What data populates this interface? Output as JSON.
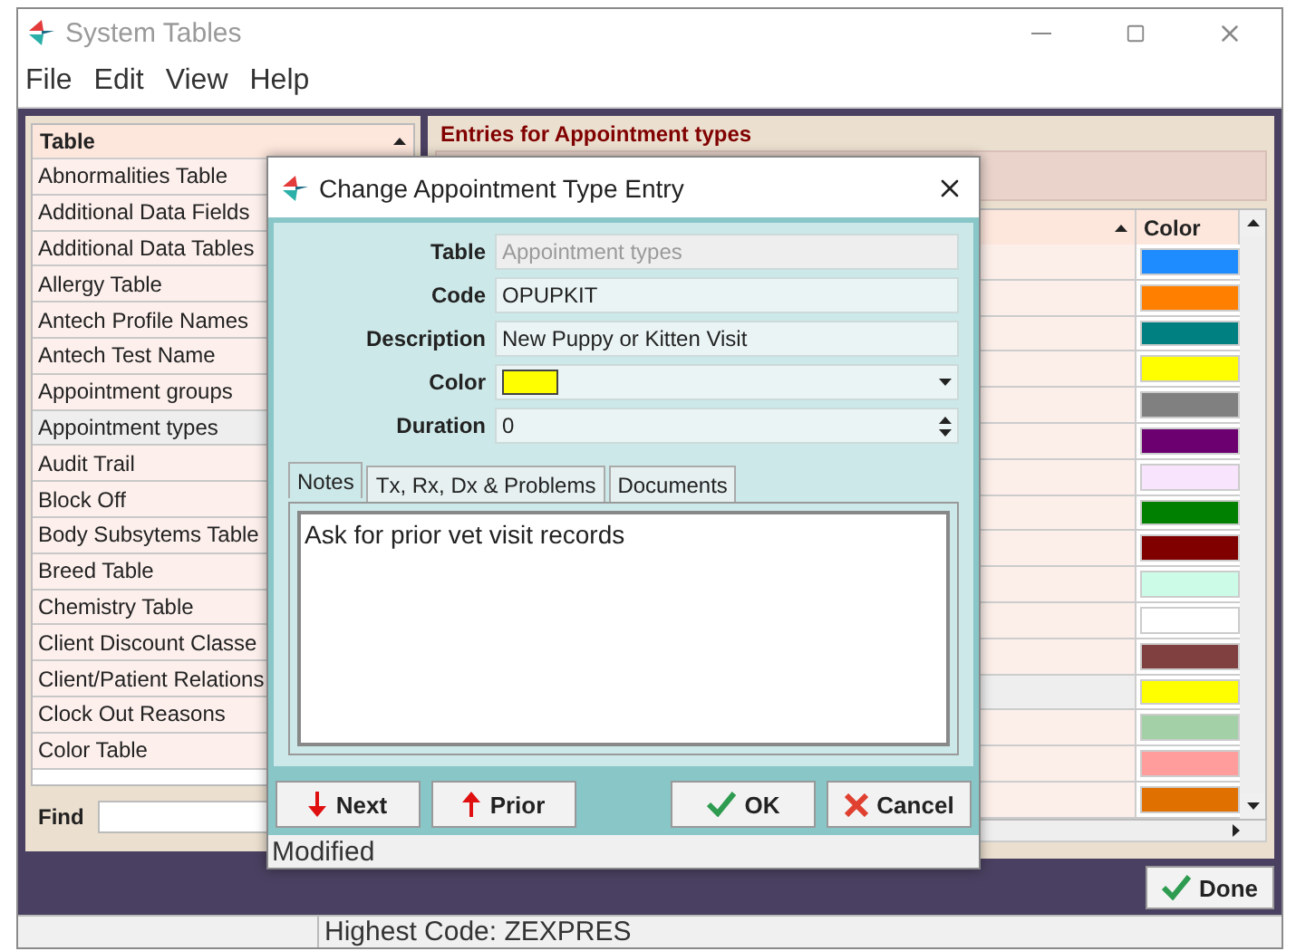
{
  "window": {
    "title": "System Tables"
  },
  "menu": [
    "File",
    "Edit",
    "View",
    "Help"
  ],
  "table_list": {
    "header": "Table",
    "items": [
      {
        "label": "Abnormalities Table",
        "selected": false
      },
      {
        "label": "Additional Data Fields",
        "selected": false
      },
      {
        "label": "Additional Data Tables",
        "selected": false
      },
      {
        "label": "Allergy Table",
        "selected": false
      },
      {
        "label": "Antech Profile Names",
        "selected": false
      },
      {
        "label": "Antech Test Name",
        "selected": false
      },
      {
        "label": "Appointment groups",
        "selected": false
      },
      {
        "label": "Appointment types",
        "selected": true
      },
      {
        "label": "Audit Trail",
        "selected": false
      },
      {
        "label": "Block Off",
        "selected": false
      },
      {
        "label": "Body Subsytems Table",
        "selected": false
      },
      {
        "label": "Breed Table",
        "selected": false
      },
      {
        "label": "Chemistry Table",
        "selected": false
      },
      {
        "label": "Client Discount Classe",
        "selected": false
      },
      {
        "label": "Client/Patient Relations",
        "selected": false
      },
      {
        "label": "Clock Out Reasons",
        "selected": false
      },
      {
        "label": "Color Table",
        "selected": false
      }
    ],
    "find_label": "Find"
  },
  "entries": {
    "title": "Entries for Appointment types",
    "color_column": "Color",
    "rows": [
      {
        "color": "#1e8cff",
        "selected": false
      },
      {
        "color": "#ff8000",
        "selected": false
      },
      {
        "color": "#008080",
        "selected": false
      },
      {
        "color": "#ffff00",
        "selected": false
      },
      {
        "color": "#808080",
        "selected": false
      },
      {
        "color": "#6c0070",
        "selected": false
      },
      {
        "color": "#f8e4fc",
        "selected": false
      },
      {
        "color": "#008000",
        "selected": false
      },
      {
        "color": "#800000",
        "selected": false
      },
      {
        "color": "#ccfce8",
        "selected": false
      },
      {
        "color": "#ffffff",
        "selected": false
      },
      {
        "color": "#804040",
        "selected": false
      },
      {
        "color": "#ffff00",
        "selected": true
      },
      {
        "color": "#a4d0a8",
        "selected": false
      },
      {
        "color": "#ff9c9c",
        "selected": false
      },
      {
        "color": "#e07000",
        "selected": false
      }
    ]
  },
  "done_button": "Done",
  "status_bar": "Highest Code: ZEXPRES",
  "dialog": {
    "title": "Change Appointment Type Entry",
    "fields": [
      {
        "kind": "text",
        "label": "Table",
        "value": "Appointment types",
        "disabled": true
      },
      {
        "kind": "text",
        "label": "Code",
        "value": "OPUPKIT",
        "disabled": false
      },
      {
        "kind": "text",
        "label": "Description",
        "value": "New Puppy or Kitten Visit",
        "disabled": false
      },
      {
        "kind": "color",
        "label": "Color",
        "color": "#ffff00"
      },
      {
        "kind": "spin",
        "label": "Duration",
        "value": "0"
      }
    ],
    "tabs": [
      {
        "label": "Notes",
        "selected": true
      },
      {
        "label": "Tx, Rx, Dx & Problems",
        "selected": false
      },
      {
        "label": "Documents",
        "selected": false
      }
    ],
    "notes": "Ask for prior vet visit records",
    "buttons": [
      {
        "kind": "next",
        "label": "Next"
      },
      {
        "kind": "prior",
        "label": "Prior"
      },
      {
        "kind": "ok",
        "label": "OK"
      },
      {
        "kind": "cancel",
        "label": "Cancel"
      }
    ],
    "status": "Modified"
  }
}
